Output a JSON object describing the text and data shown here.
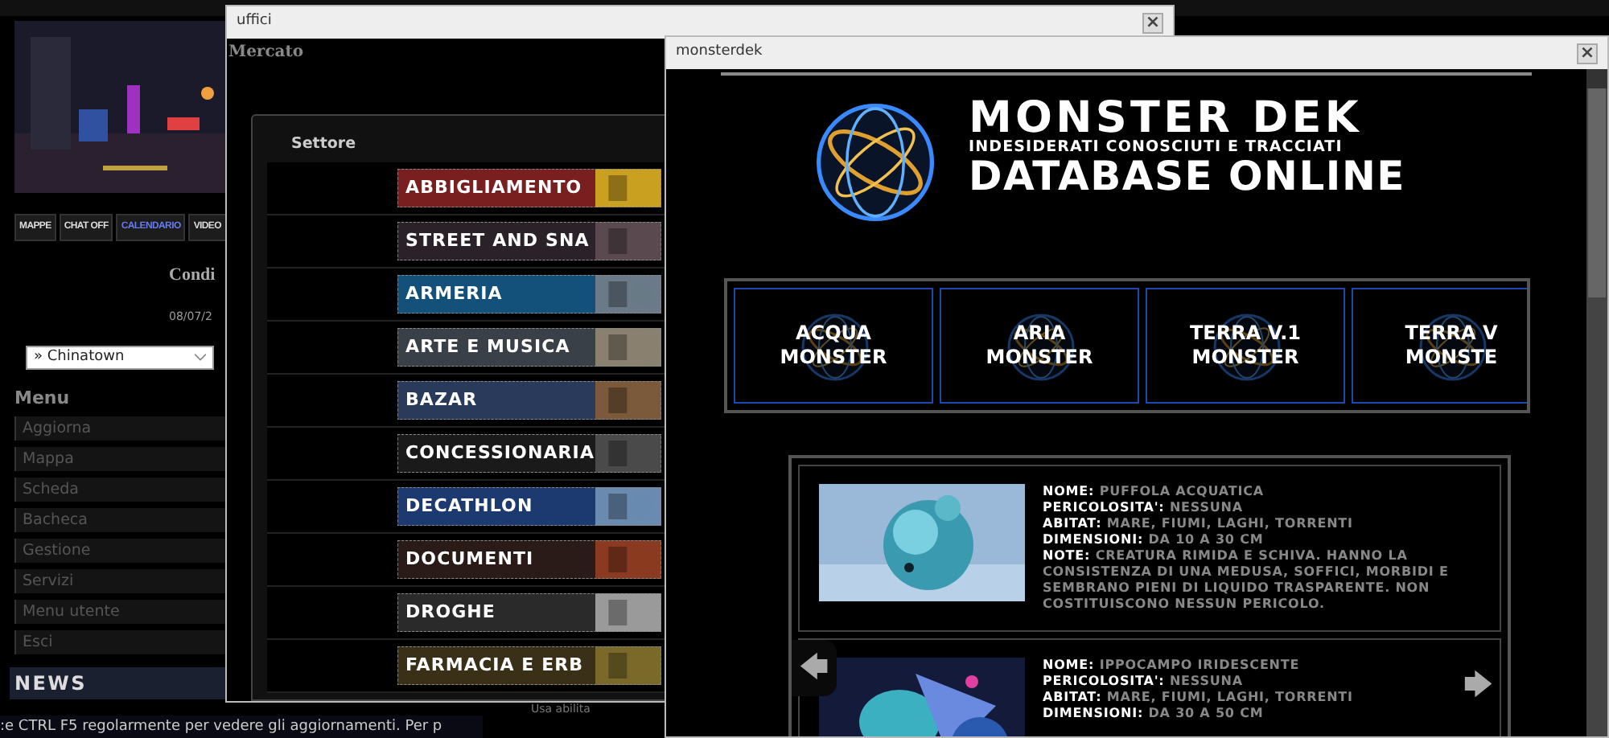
{
  "page": {
    "top_buttons": [
      {
        "label": "MAPPE",
        "selected": false
      },
      {
        "label": "CHAT OFF",
        "selected": false
      },
      {
        "label": "CALENDARIO",
        "selected": true
      },
      {
        "label": "VIDEO",
        "selected": false
      }
    ],
    "heading": "Condi",
    "date": "08/07/2",
    "location_select": {
      "value": "» Chinatown"
    },
    "menu_title": "Menu",
    "menu": [
      "Aggiorna",
      "Mappa",
      "Scheda",
      "Bacheca",
      "Gestione",
      "Servizi",
      "Menu utente",
      "Esci"
    ],
    "news_title": "NEWS",
    "background_text": "Usa abilita",
    "ticker": ":e CTRL F5 regolarmente per vedere gli aggiornamenti. Per p"
  },
  "uffici": {
    "title": "uffici",
    "close": "×",
    "heading": "Mercato",
    "panel_title": "Settore",
    "sectors": [
      {
        "kind": "label",
        "label": "ABBIGLIAMENTO"
      },
      {
        "kind": "label",
        "label": "STREET AND SNA"
      },
      {
        "kind": "label",
        "label": "ARMERIA"
      },
      {
        "kind": "label",
        "label": "ARTE E MUSICA"
      },
      {
        "kind": "label",
        "label": "BAZAR"
      },
      {
        "kind": "label",
        "label": "CONCESSIONARIA"
      },
      {
        "kind": "label",
        "label": "DECATHLON"
      },
      {
        "kind": "label",
        "label": "DOCUMENTI"
      },
      {
        "kind": "label",
        "label": "DROGHE"
      },
      {
        "kind": "label",
        "label": "FARMACIA E ERB"
      }
    ]
  },
  "monsterdek": {
    "title": "monsterdek",
    "close": "×",
    "logo": {
      "title": "MONSTER DEK",
      "subtitle": "INDESIDERATI CONOSCIUTI E TRACCIATI",
      "tagline": "DATABASE ONLINE"
    },
    "categories": [
      {
        "lines": [
          "ACQUA",
          "MONSTER"
        ]
      },
      {
        "lines": [
          "ARIA",
          "MONSTER"
        ]
      },
      {
        "lines": [
          "TERRA V.1",
          "MONSTER"
        ]
      },
      {
        "lines": [
          "TERRA V",
          "MONSTE"
        ]
      }
    ],
    "entries": [
      {
        "fields": [
          {
            "label": "NOME:",
            "value": "PUFFOLA ACQUATICA"
          },
          {
            "label": "PERICOLOSITA':",
            "value": "NESSUNA"
          },
          {
            "label": "ABITAT:",
            "value": "MARE, FIUMI, LAGHI, TORRENTI"
          },
          {
            "label": "DIMENSIONI:",
            "value": "DA 10 A 30 CM"
          },
          {
            "label": "NOTE:",
            "value": "CREATURA RIMIDA E SCHIVA. HANNO LA CONSISTENZA DI UNA MEDUSA, SOFFICI, MORBIDI E SEMBRANO PIENI DI LIQUIDO TRASPARENTE. NON COSTITUISCONO NESSUN PERICOLO."
          }
        ]
      },
      {
        "fields": [
          {
            "label": "NOME:",
            "value": "IPPOCAMPO IRIDESCENTE"
          },
          {
            "label": "PERICOLOSITA':",
            "value": "NESSUNA"
          },
          {
            "label": "ABITAT:",
            "value": "MARE, FIUMI, LAGHI, TORRENTI"
          },
          {
            "label": "DIMENSIONI:",
            "value": "DA 30 A 50 CM"
          }
        ]
      }
    ],
    "prev_arrow": "🡄",
    "next_arrow": "🡆"
  }
}
